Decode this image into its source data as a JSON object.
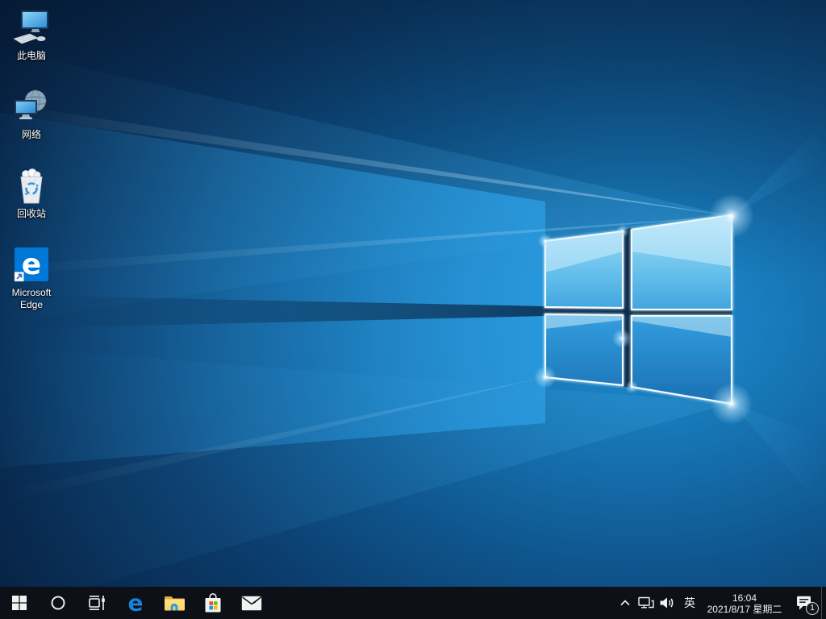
{
  "desktop": {
    "icons": [
      {
        "label": "此电脑"
      },
      {
        "label": "网络"
      },
      {
        "label": "回收站"
      },
      {
        "label": "Microsoft Edge"
      }
    ]
  },
  "taskbar": {
    "tray": {
      "ime": "英",
      "time": "16:04",
      "date": "2021/8/17 星期二",
      "notification_badge": "1"
    }
  },
  "branding": {
    "edge_glyph": "e"
  },
  "colors": {
    "accent_blue": "#0078d7",
    "taskbar_bg": "#0d1016",
    "wallpaper_dark": "#041226",
    "wallpaper_accent": "#2e9fe0",
    "store_red": "#f25022",
    "store_green": "#7fba00",
    "store_blue": "#00a4ef",
    "store_yellow": "#ffb900"
  }
}
